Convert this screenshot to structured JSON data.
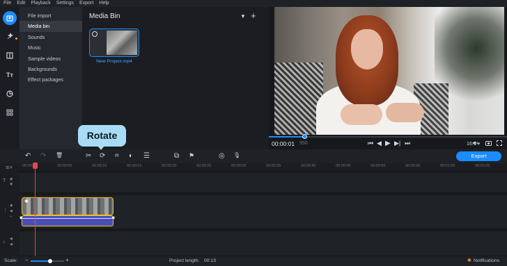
{
  "menu": [
    "File",
    "Edit",
    "Playback",
    "Settings",
    "Export",
    "Help"
  ],
  "rail_icons": [
    "import-icon",
    "magic-wand-icon",
    "transitions-icon",
    "titles-icon",
    "stickers-icon",
    "more-tools-icon"
  ],
  "categories": [
    {
      "label": "File import",
      "active": false
    },
    {
      "label": "Media bin",
      "active": true
    },
    {
      "label": "Sounds",
      "active": false
    },
    {
      "label": "Music",
      "active": false
    },
    {
      "label": "Sample videos",
      "active": false
    },
    {
      "label": "Backgrounds",
      "active": false
    },
    {
      "label": "Effect packages",
      "active": false
    }
  ],
  "media_bin": {
    "title": "Media Bin",
    "filter_icon": "▼",
    "add_icon": "+",
    "file_name": "New Project.mp4",
    "check": "✓"
  },
  "player": {
    "time_current": "00:00:01",
    "time_frames": "950",
    "aspect_ratio": "16:9 ▾",
    "progress_fraction": 0.15,
    "controls": [
      "⏮",
      "◀",
      "▶",
      "▶|",
      "⏭"
    ]
  },
  "toolbar": {
    "export_label": "Export",
    "tooltip": "Rotate",
    "icons": [
      "↶",
      "↷",
      "🗑",
      "✂",
      "⟳",
      "⌗",
      "◐",
      "☰",
      "⧉",
      "⚑",
      "◎",
      "🎙"
    ]
  },
  "ruler": {
    "labels": [
      "00:00:00",
      "00:00:05",
      "00:00:10",
      "00:00:15",
      "00:00:20",
      "00:00:25",
      "00:00:30",
      "00:00:35",
      "00:00:40",
      "00:00:45",
      "00:00:50",
      "00:00:55",
      "00:01:00",
      "00:01:05"
    ]
  },
  "status": {
    "scale_label": "Scale:",
    "project_length_label": "Project length:",
    "project_length_value": "00:13",
    "notifications_label": "Notifications",
    "scale_fraction": 0.58
  },
  "colors": {
    "accent": "#1a8cff",
    "clip_border": "#f2c21b",
    "playhead": "#e0484c",
    "tooltip": "#a8dcf5"
  }
}
